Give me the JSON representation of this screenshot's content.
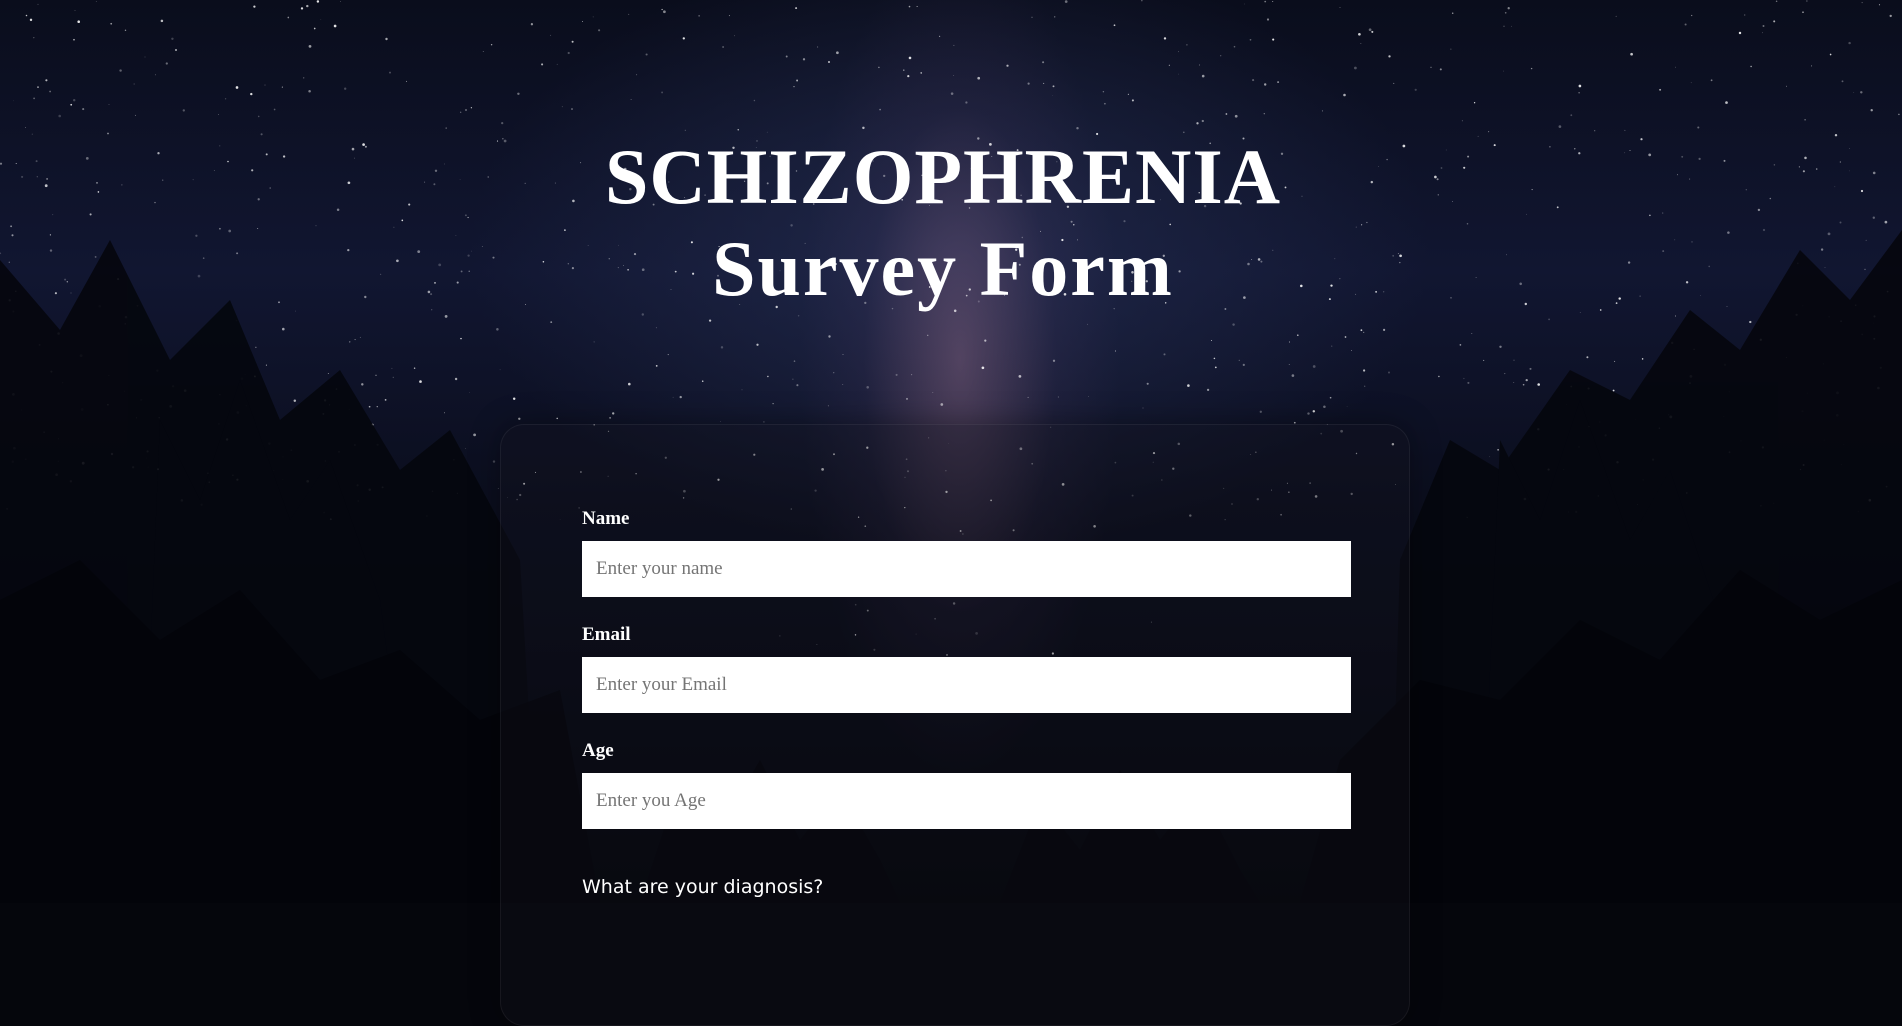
{
  "header": {
    "title_line1": "SCHIZOPHRENIA",
    "title_line2": "Survey Form"
  },
  "form": {
    "name": {
      "label": "Name",
      "placeholder": "Enter your name",
      "value": ""
    },
    "email": {
      "label": "Email",
      "placeholder": "Enter your Email",
      "value": ""
    },
    "age": {
      "label": "Age",
      "placeholder": "Enter you Age",
      "value": ""
    },
    "diagnosis": {
      "question": "What are your diagnosis?"
    }
  },
  "colors": {
    "text": "#ffffff",
    "input_bg": "#ffffff",
    "background": "#0b0e1e"
  }
}
